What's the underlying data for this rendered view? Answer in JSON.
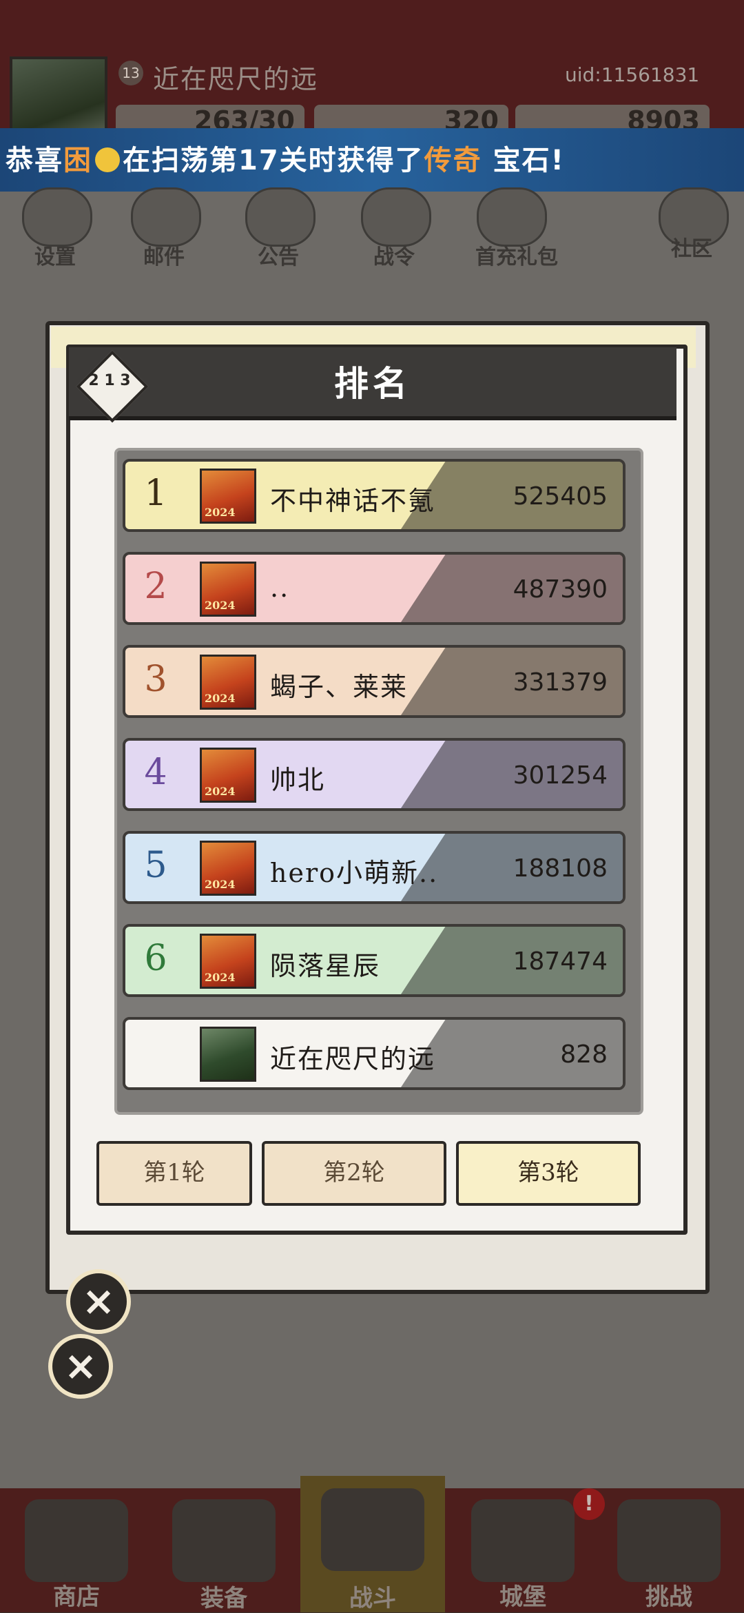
{
  "profile": {
    "level": "13",
    "name": "近在咫尺的远",
    "uid": "uid:11561831",
    "resources": [
      "263/30",
      "320",
      "8903"
    ]
  },
  "ticker": {
    "prefix": "恭喜",
    "player": "困",
    "middle": "在扫荡第17关时获得了",
    "item": "传奇",
    "suffix": "宝石!"
  },
  "top_menu": [
    "设置",
    "邮件",
    "公告",
    "战令",
    "首充礼包",
    "社区"
  ],
  "popup": {
    "title": "排名",
    "emblem": "2 1 3",
    "rows": [
      {
        "rank": "1",
        "name": "不中神话不氪",
        "score": "525405",
        "color": "#f4ecb4",
        "rank_color": "#3a2c14"
      },
      {
        "rank": "2",
        "name": "..",
        "score": "487390",
        "color": "#f5cfcf",
        "rank_color": "#b44a4a"
      },
      {
        "rank": "3",
        "name": "蝎子、莱莱",
        "score": "331379",
        "color": "#f4dcc6",
        "rank_color": "#a0522d"
      },
      {
        "rank": "4",
        "name": "帅北",
        "score": "301254",
        "color": "#e2d8f2",
        "rank_color": "#6a4a9c"
      },
      {
        "rank": "5",
        "name": "hero小萌新..",
        "score": "188108",
        "color": "#d5e6f4",
        "rank_color": "#2d5a8c"
      },
      {
        "rank": "6",
        "name": "陨落星辰",
        "score": "187474",
        "color": "#d3ecd0",
        "rank_color": "#2f7a3a"
      },
      {
        "rank": "",
        "name": "近在咫尺的远",
        "score": "828",
        "color": "#f6f4f0",
        "rank_color": "#1f1b18"
      }
    ],
    "avatar_badge": "2024",
    "rounds": [
      "第1轮",
      "第2轮",
      "第3轮"
    ],
    "selected_round": "第3轮"
  },
  "bottom_nav": [
    "商店",
    "装备",
    "战斗",
    "城堡",
    "挑战"
  ],
  "nav_badge": "!"
}
